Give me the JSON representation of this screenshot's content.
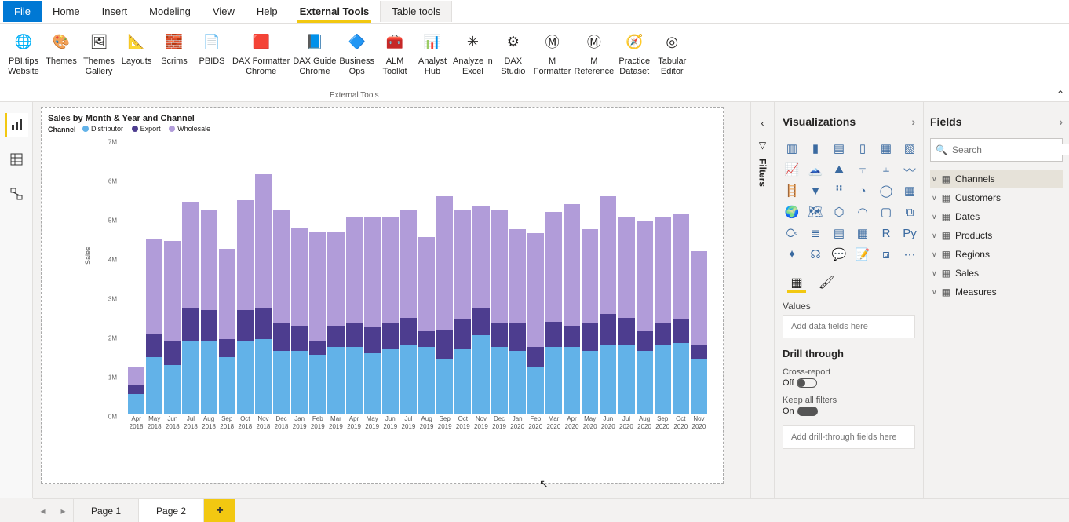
{
  "menu": {
    "file": "File",
    "home": "Home",
    "insert": "Insert",
    "modeling": "Modeling",
    "view": "View",
    "help": "Help",
    "external_tools": "External Tools",
    "table_tools": "Table tools"
  },
  "ribbon": {
    "group_label": "External Tools",
    "tools": [
      {
        "label": "PBI.tips\nWebsite",
        "icon": "🌐"
      },
      {
        "label": "Themes",
        "icon": "🎨"
      },
      {
        "label": "Themes\nGallery",
        "icon": "🖼"
      },
      {
        "label": "Layouts",
        "icon": "📐"
      },
      {
        "label": "Scrims",
        "icon": "🧱"
      },
      {
        "label": "PBIDS",
        "icon": "📄"
      },
      {
        "label": "DAX Formatter\nChrome",
        "icon": "🟥"
      },
      {
        "label": "DAX.Guide\nChrome",
        "icon": "📘"
      },
      {
        "label": "Business\nOps",
        "icon": "🔷"
      },
      {
        "label": "ALM\nToolkit",
        "icon": "🧰"
      },
      {
        "label": "Analyst\nHub",
        "icon": "📊"
      },
      {
        "label": "Analyze in\nExcel",
        "icon": "✳"
      },
      {
        "label": "DAX\nStudio",
        "icon": "⚙"
      },
      {
        "label": "M\nFormatter",
        "icon": "Ⓜ"
      },
      {
        "label": "M\nReference",
        "icon": "Ⓜ"
      },
      {
        "label": "Practice\nDataset",
        "icon": "🧭"
      },
      {
        "label": "Tabular\nEditor",
        "icon": "◎"
      }
    ]
  },
  "chart_data": {
    "type": "bar",
    "title": "Sales by Month & Year and Channel",
    "legend_title": "Channel",
    "ylabel": "Sales",
    "ylim": [
      0,
      7000000
    ],
    "y_ticks": [
      "0M",
      "1M",
      "2M",
      "3M",
      "4M",
      "5M",
      "6M",
      "7M"
    ],
    "series_names": [
      "Distributor",
      "Export",
      "Wholesale"
    ],
    "series_colors": [
      "#62b2e8",
      "#4d3d8f",
      "#b19cd9"
    ],
    "categories": [
      "Apr 2018",
      "May 2018",
      "Jun 2018",
      "Jul 2018",
      "Aug 2018",
      "Sep 2018",
      "Oct 2018",
      "Nov 2018",
      "Dec 2018",
      "Jan 2019",
      "Feb 2019",
      "Mar 2019",
      "Apr 2019",
      "May 2019",
      "Jun 2019",
      "Jul 2019",
      "Aug 2019",
      "Sep 2019",
      "Oct 2019",
      "Nov 2019",
      "Dec 2019",
      "Jan 2020",
      "Feb 2020",
      "Mar 2020",
      "Apr 2020",
      "May 2020",
      "Jun 2020",
      "Jul 2020",
      "Aug 2020",
      "Sep 2020",
      "Oct 2020",
      "Nov 2020"
    ],
    "series": [
      {
        "name": "Distributor",
        "values": [
          500000,
          1450000,
          1250000,
          1850000,
          1850000,
          1450000,
          1850000,
          1900000,
          1600000,
          1600000,
          1500000,
          1700000,
          1700000,
          1550000,
          1650000,
          1750000,
          1700000,
          1400000,
          1650000,
          2000000,
          1700000,
          1600000,
          1200000,
          1700000,
          1700000,
          1600000,
          1750000,
          1750000,
          1600000,
          1750000,
          1800000,
          1400000
        ]
      },
      {
        "name": "Export",
        "values": [
          250000,
          600000,
          600000,
          850000,
          800000,
          450000,
          800000,
          800000,
          700000,
          650000,
          350000,
          550000,
          600000,
          650000,
          650000,
          700000,
          400000,
          750000,
          750000,
          700000,
          600000,
          700000,
          500000,
          650000,
          550000,
          700000,
          800000,
          700000,
          500000,
          550000,
          600000,
          350000
        ]
      },
      {
        "name": "Wholesale",
        "values": [
          450000,
          2400000,
          2550000,
          2700000,
          2550000,
          2300000,
          2800000,
          3400000,
          2900000,
          2500000,
          2800000,
          2400000,
          2700000,
          2800000,
          2700000,
          2750000,
          2400000,
          3400000,
          2800000,
          2600000,
          2900000,
          2400000,
          2900000,
          2800000,
          3100000,
          2400000,
          3000000,
          2550000,
          2800000,
          2700000,
          2700000,
          2400000
        ]
      }
    ]
  },
  "filters": {
    "label": "Filters"
  },
  "viz": {
    "title": "Visualizations",
    "values_label": "Values",
    "values_placeholder": "Add data fields here",
    "drillthrough_title": "Drill through",
    "cross_report": "Cross-report",
    "cross_report_state": "Off",
    "keep_filters": "Keep all filters",
    "keep_filters_state": "On",
    "drill_placeholder": "Add drill-through fields here"
  },
  "fields": {
    "title": "Fields",
    "search_placeholder": "Search",
    "tables": [
      "Channels",
      "Customers",
      "Dates",
      "Products",
      "Regions",
      "Sales",
      "Measures"
    ]
  },
  "pages": {
    "page1": "Page 1",
    "page2": "Page 2"
  }
}
